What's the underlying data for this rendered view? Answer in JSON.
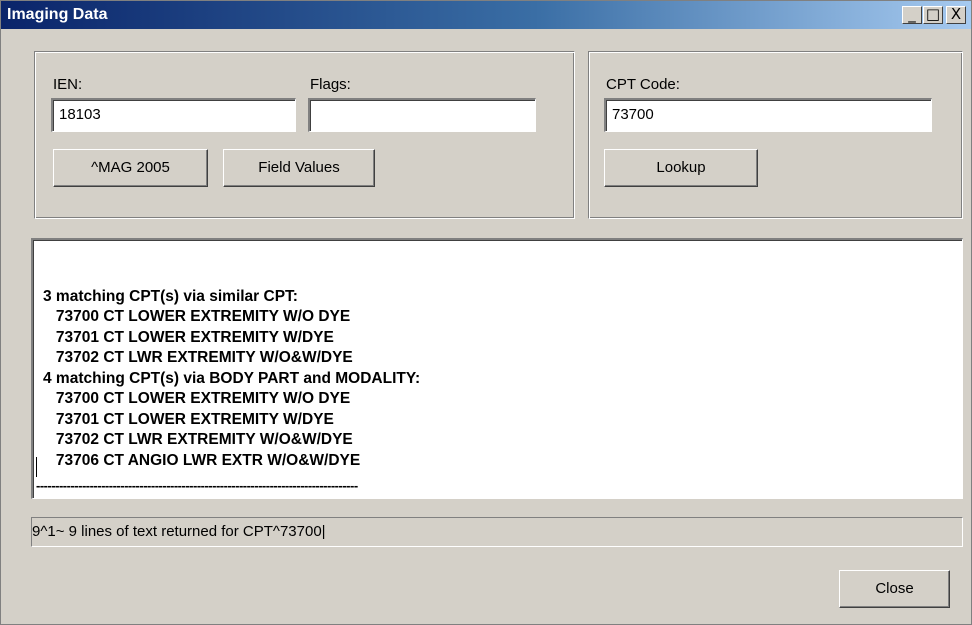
{
  "window": {
    "title": "Imaging Data",
    "minimize_glyph": "_",
    "maximize_glyph": "□",
    "close_glyph": "X"
  },
  "lookup_panel": {
    "ien_label": "IEN:",
    "ien_value": "18103",
    "flags_label": "Flags:",
    "flags_value": "",
    "mag_button": "^MAG 2005",
    "field_values_button": "Field Values"
  },
  "cpt_panel": {
    "cpt_label": "CPT Code:",
    "cpt_value": "73700",
    "lookup_button": "Lookup"
  },
  "results": {
    "lines": [
      "3 matching CPT(s) via similar CPT:",
      "   73700 CT LOWER EXTREMITY W/O DYE",
      "   73701 CT LOWER EXTREMITY W/DYE",
      "   73702 CT LWR EXTREMITY W/O&W/DYE",
      "4 matching CPT(s) via BODY PART and MODALITY:",
      "   73700 CT LOWER EXTREMITY W/O DYE",
      "   73701 CT LOWER EXTREMITY W/DYE",
      "   73702 CT LWR EXTREMITY W/O&W/DYE",
      "   73706 CT ANGIO LWR EXTR W/O&W/DYE"
    ],
    "separator": "------------------------------------------------------------------------------------"
  },
  "status_bar": {
    "text": "9^1~ 9 lines of text returned for CPT^73700|"
  },
  "footer": {
    "close_button": "Close"
  }
}
